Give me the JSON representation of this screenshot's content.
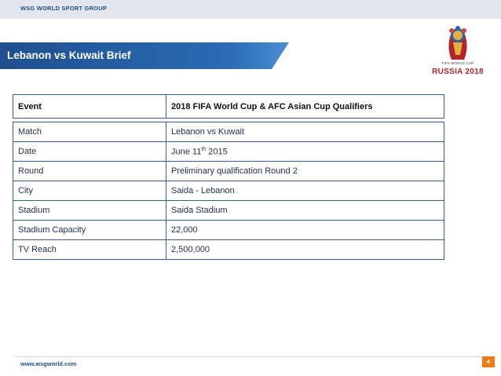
{
  "header": {
    "brand": "WSG WORLD SPORT GROUP"
  },
  "slide": {
    "title": "Lebanon vs Kuwait Brief"
  },
  "logo": {
    "wordmark": "RUSSIA 2018",
    "cup_text": "FIFA WORLD CUP"
  },
  "table": {
    "header": {
      "label": "Event",
      "value": "2018 FIFA World Cup  & AFC Asian Cup Qualifiers"
    },
    "rows": [
      {
        "label": "Match",
        "value": "Lebanon vs Kuwait"
      },
      {
        "label": "Date",
        "value": "June 11th 2015"
      },
      {
        "label": "Round",
        "value": "Preliminary qualification Round 2"
      },
      {
        "label": "City",
        "value": "Saida - Lebanon"
      },
      {
        "label": "Stadium",
        "value": "Saida Stadium"
      },
      {
        "label": "Stadium Capacity",
        "value": "22,000"
      },
      {
        "label": "TV Reach",
        "value": "2,500,000"
      }
    ]
  },
  "date_parts": {
    "day": "June 11",
    "suffix": "th",
    "year": " 2015"
  },
  "footer": {
    "url": "www.wsgworld.com",
    "page_number": "4"
  },
  "colors": {
    "title_bar": "#1e4f8f",
    "accent": "#ef7b16",
    "table_border": "#2f5f9a"
  }
}
